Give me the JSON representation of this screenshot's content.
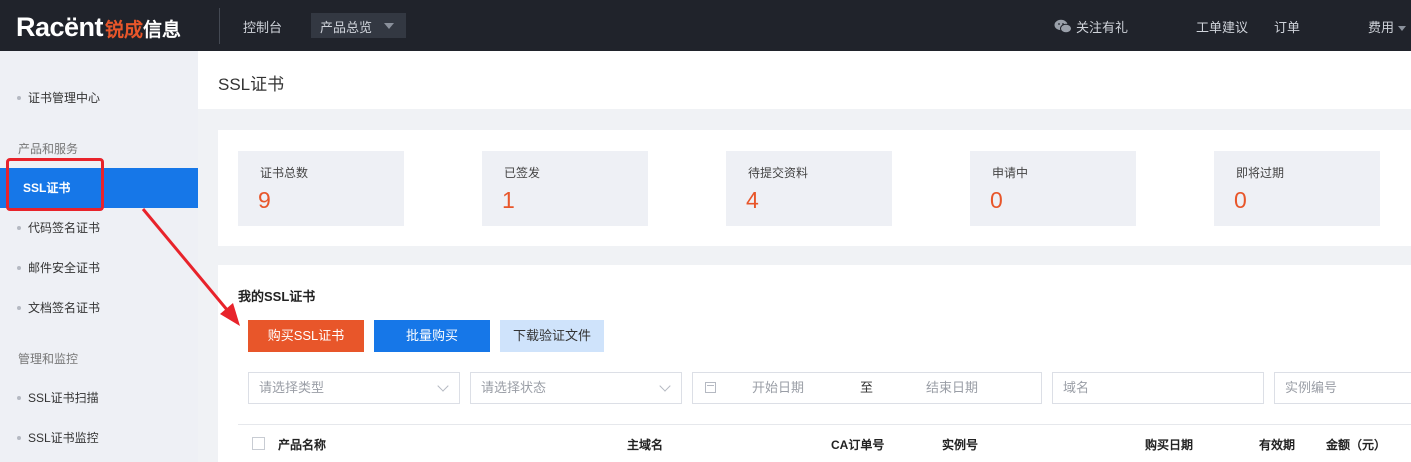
{
  "header": {
    "logo_latin": "Racënt",
    "logo_cn_accent": "锐成",
    "logo_cn": "信息",
    "console": "控制台",
    "products": "产品总览",
    "wechat": "关注有礼",
    "ticket": "工单建议",
    "order": "订单",
    "fee": "费用"
  },
  "sidebar": {
    "center": "证书管理中心",
    "group1": "产品和服务",
    "items": [
      "SSL证书",
      "代码签名证书",
      "邮件安全证书",
      "文档签名证书"
    ],
    "group2": "管理和监控",
    "items2": [
      "SSL证书扫描",
      "SSL证书监控"
    ]
  },
  "page": {
    "title": "SSL证书"
  },
  "stats": [
    {
      "label": "证书总数",
      "value": "9"
    },
    {
      "label": "已签发",
      "value": "1"
    },
    {
      "label": "待提交资料",
      "value": "4"
    },
    {
      "label": "申请中",
      "value": "0"
    },
    {
      "label": "即将过期",
      "value": "0"
    }
  ],
  "list": {
    "title": "我的SSL证书",
    "buttons": {
      "buy": "购买SSL证书",
      "bulk": "批量购买",
      "download": "下载验证文件"
    },
    "filters": {
      "type": "请选择类型",
      "status": "请选择状态",
      "date_start": "开始日期",
      "date_sep": "至",
      "date_end": "结束日期",
      "domain": "域名",
      "instance": "实例编号"
    },
    "columns": [
      "产品名称",
      "主域名",
      "CA订单号",
      "实例号",
      "购买日期",
      "有效期",
      "金额（元）"
    ]
  },
  "colors": {
    "accent": "#e8562a",
    "primary": "#1677e8",
    "annotation": "#e8232b"
  }
}
